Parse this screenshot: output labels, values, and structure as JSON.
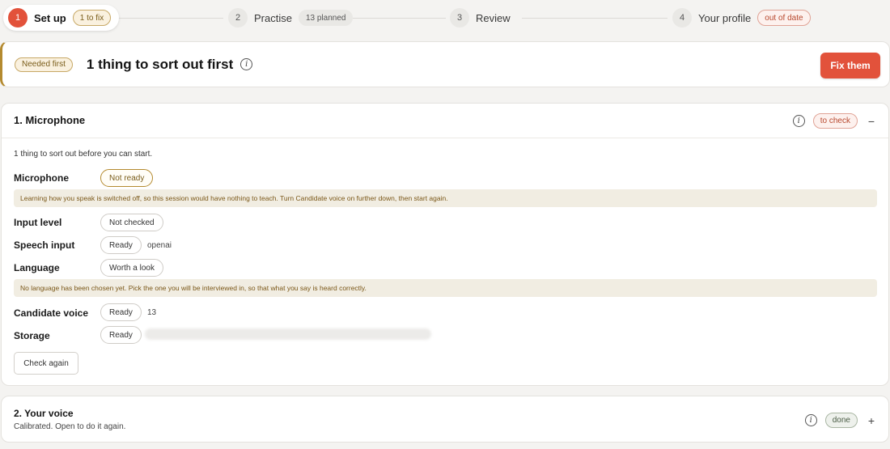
{
  "stepper": {
    "steps": [
      {
        "number": "1",
        "label": "Set up",
        "badge": "1 to fix"
      },
      {
        "number": "2",
        "label": "Practise",
        "badge": "13 planned"
      },
      {
        "number": "3",
        "label": "Review"
      },
      {
        "number": "4",
        "label": "Your profile",
        "badge": "out of date"
      }
    ],
    "active_step": 1
  },
  "alert": {
    "badge": "Needed first",
    "title": "1 thing to sort out first",
    "action": "Fix them"
  },
  "microphone_section": {
    "title": "1. Microphone",
    "status": "to check",
    "toggle": "−",
    "intro": "1 thing to sort out before you can start.",
    "rows": [
      {
        "label": "Microphone",
        "status": "Not ready"
      },
      {
        "label": "Input level",
        "status": "Not checked"
      },
      {
        "label": "Speech input",
        "status": "Ready",
        "detail": "openai"
      },
      {
        "label": "Language",
        "status": "Worth a look"
      },
      {
        "label": "Candidate voice",
        "status": "Ready",
        "detail": "13"
      },
      {
        "label": "Storage",
        "status": "Ready"
      }
    ],
    "notes": {
      "microphone": "Learning how you speak is switched off, so this session would have nothing to teach. Turn Candidate voice on further down, then start again.",
      "language": "No language has been chosen yet. Pick the one you will be interviewed in, so that what you say is heard correctly."
    },
    "check_again": "Check again"
  },
  "voice_section": {
    "title": "2. Your voice",
    "subtitle": "Calibrated. Open to do it again.",
    "status": "done",
    "toggle": "+"
  },
  "icons": {
    "info": "info-icon"
  },
  "colors": {
    "accent": "#e2523b",
    "warning": "#b48a2f",
    "note_bg": "#f1ede2",
    "done": "#4b5d46"
  }
}
